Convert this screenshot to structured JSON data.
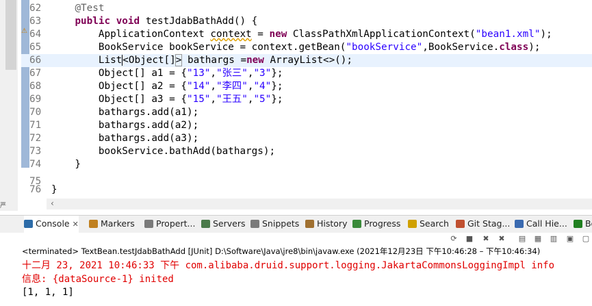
{
  "editor": {
    "lines": [
      {
        "n": "62",
        "code": "    @Test"
      },
      {
        "n": "63",
        "code": "    public void testJdabBathAdd() {"
      },
      {
        "n": "64",
        "code": "        ApplicationContext context = new ClassPathXmlApplicationContext(\"bean1.xml\");"
      },
      {
        "n": "65",
        "code": "        BookService bookService = context.getBean(\"bookService\",BookService.class);"
      },
      {
        "n": "66",
        "code": "        List<Object[]> bathargs =new ArrayList<>();"
      },
      {
        "n": "67",
        "code": "        Object[] a1 = {\"13\",\"张三\",\"3\"};"
      },
      {
        "n": "68",
        "code": "        Object[] a2 = {\"14\",\"李四\",\"4\"};"
      },
      {
        "n": "69",
        "code": "        Object[] a3 = {\"15\",\"王五\",\"5\"};"
      },
      {
        "n": "70",
        "code": "        bathargs.add(a1);"
      },
      {
        "n": "71",
        "code": "        bathargs.add(a2);"
      },
      {
        "n": "72",
        "code": "        bathargs.add(a3);"
      },
      {
        "n": "73",
        "code": "        bookService.bathAdd(bathargs);"
      },
      {
        "n": "74",
        "code": "    }"
      },
      {
        "n": "75",
        "code": ""
      },
      {
        "n": "76",
        "code": "}"
      }
    ],
    "left_stub": "严"
  },
  "tabs": [
    {
      "label": "Console",
      "icon": "console-icon",
      "active": true
    },
    {
      "label": "Markers",
      "icon": "markers-icon"
    },
    {
      "label": "Propert...",
      "icon": "properties-icon"
    },
    {
      "label": "Servers",
      "icon": "servers-icon"
    },
    {
      "label": "Snippets",
      "icon": "snippets-icon"
    },
    {
      "label": "History",
      "icon": "history-icon"
    },
    {
      "label": "Progress",
      "icon": "progress-icon"
    },
    {
      "label": "Search",
      "icon": "search-icon"
    },
    {
      "label": "Git Stag...",
      "icon": "git-staging-icon"
    },
    {
      "label": "Call Hie...",
      "icon": "call-hierarchy-icon"
    },
    {
      "label": "Bo",
      "icon": "bookmarks-icon"
    }
  ],
  "console": {
    "status": "<terminated> TextBean.testJdabBathAdd [JUnit] D:\\Software\\Java\\jre8\\bin\\javaw.exe  (2021年12月23日 下午10:46:28 – 下午10:46:34)",
    "output": [
      {
        "text": "十二月 23, 2021 10:46:33 下午 com.alibaba.druid.support.logging.JakartaCommonsLoggingImpl info",
        "style": "err"
      },
      {
        "text": "信息: {dataSource-1} inited",
        "style": "err"
      },
      {
        "text": "[1, 1, 1]",
        "style": "norm"
      }
    ]
  },
  "colors": {
    "keyword": "#7f0055",
    "string": "#2a00ff",
    "annotation": "#646464",
    "stderr": "#e00000",
    "current_line": "#e8f2fe"
  }
}
